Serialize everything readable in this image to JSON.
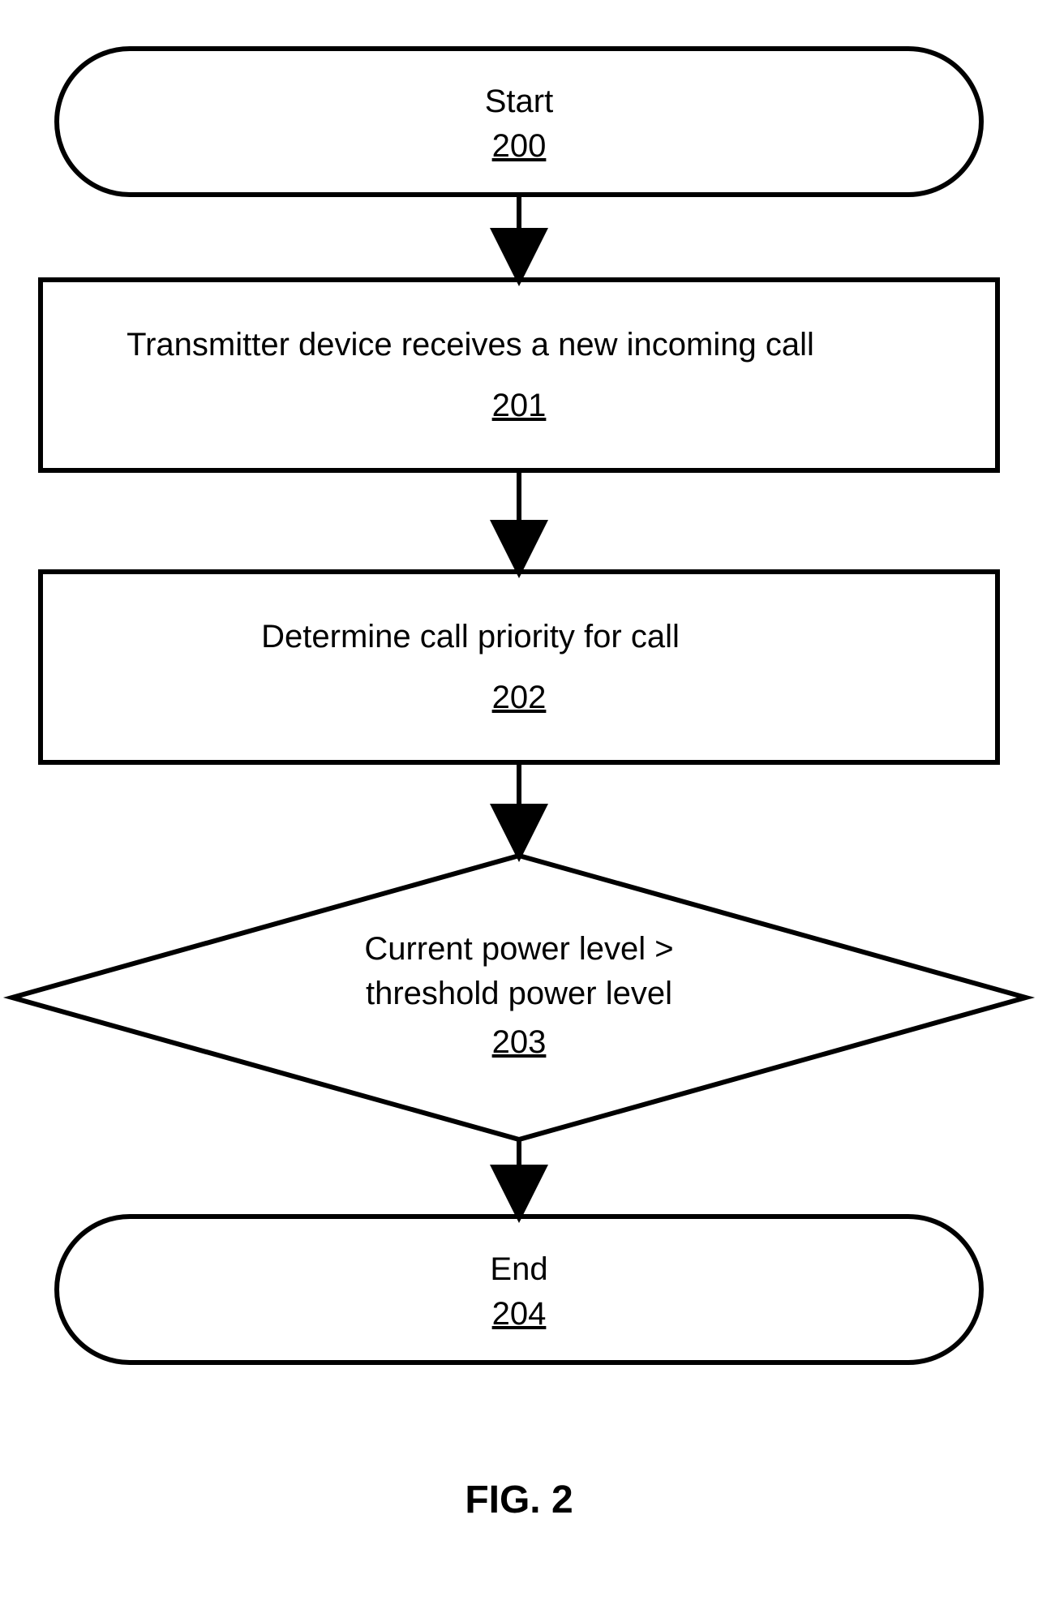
{
  "flowchart": {
    "start": {
      "title": "Start",
      "num": "200"
    },
    "step1": {
      "title": "Transmitter device receives a new incoming call",
      "num": "201"
    },
    "step2": {
      "title": "Determine call priority for call",
      "num": "202"
    },
    "decision": {
      "line1": "Current power level >",
      "line2": "threshold power level",
      "num": "203"
    },
    "end": {
      "title": "End",
      "num": "204"
    }
  },
  "figure_caption": "FIG. 2"
}
